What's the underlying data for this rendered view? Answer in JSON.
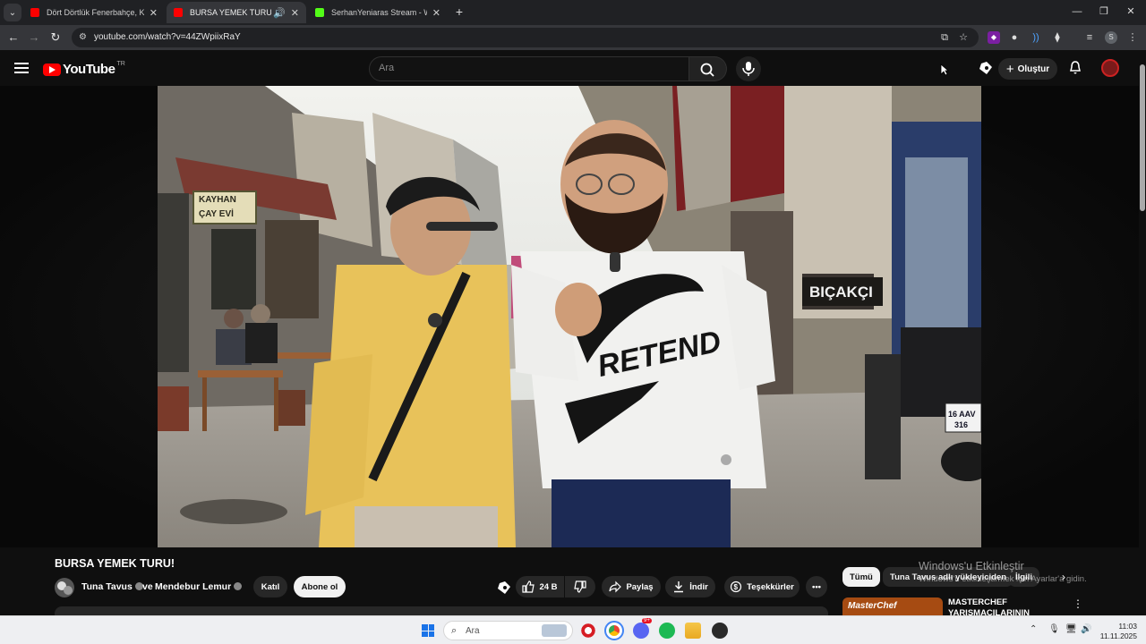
{
  "browser": {
    "tabs": [
      {
        "title": "Dört Dörtlük Fenerbahçe, Kocae",
        "favicon_color": "#ff0000",
        "active": false
      },
      {
        "title": "BURSA YEMEK TURU! - You",
        "favicon_color": "#ff0000",
        "active": true
      },
      {
        "title": "SerhanYeniaras Stream - Watch",
        "favicon_color": "#53fc18",
        "active": false
      }
    ],
    "url": "youtube.com/watch?v=44ZWpiixRaY"
  },
  "youtube": {
    "logo_text": "YouTube",
    "region": "TR",
    "search_placeholder": "Ara",
    "create_label": "Oluştur"
  },
  "video": {
    "title": "BURSA YEMEK TURU!",
    "channel_primary": "Tuna Tavus",
    "channel_joiner": "ve",
    "channel_secondary": "Mendebur Lemur",
    "join_label": "Katıl",
    "subscribe_label": "Abone ol",
    "likes": "24 B",
    "share_label": "Paylaş",
    "download_label": "İndir",
    "thanks_label": "Teşekkürler",
    "scene_signs": {
      "cafe_sign_line1": "KAYHAN",
      "cafe_sign_line2": "ÇAY EVİ",
      "shop_sign": "BIÇAKÇI",
      "shirt_text": "RETEND",
      "plate_line1": "16 AAV",
      "plate_line2": "316"
    }
  },
  "sidebar": {
    "chips": [
      "Tümü",
      "Tuna Tavus adlı yükleyiciden",
      "İlgili"
    ],
    "recommendation_title": "MASTERCHEF YARIŞMACILARININ",
    "recommendation_thumb_text": "MasterChef"
  },
  "overlay": {
    "activation_title": "Windows'u Etkinleştir",
    "activation_subtitle": "Windows'u etkinleştirmek için Ayarlar'a gidin."
  },
  "taskbar": {
    "search_placeholder": "Ara",
    "time": "11:03",
    "date": "11.11.2025",
    "discord_badge": "9+"
  }
}
